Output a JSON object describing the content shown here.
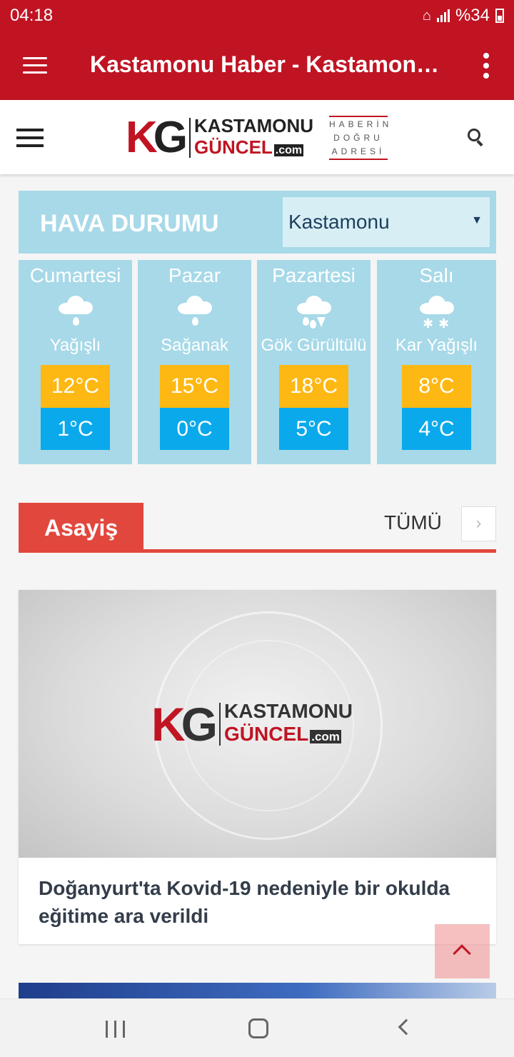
{
  "status_bar": {
    "time": "04:18",
    "battery": "%34",
    "icons": [
      "wifi-icon",
      "signal-icon",
      "battery-icon"
    ]
  },
  "app_bar": {
    "title": "Kastamonu Haber - Kastamon…",
    "icons": [
      "menu-icon",
      "more-vert-icon"
    ]
  },
  "site_header": {
    "logo": {
      "k": "K",
      "g": "G",
      "word1": "KASTAMONU",
      "word2": "GÜNCEL",
      "com": ".com"
    },
    "slogan": [
      "HABERİN",
      "DOĞRU",
      "ADRESİ"
    ],
    "icons": [
      "hamburger-icon",
      "search-icon"
    ]
  },
  "weather": {
    "title": "HAVA DURUMU",
    "city": "Kastamonu",
    "days": [
      {
        "name": "Cumartesi",
        "condition": "Yağışlı",
        "high": "12°C",
        "low": "1°C",
        "icon": "rain-icon"
      },
      {
        "name": "Pazar",
        "condition": "Sağanak",
        "high": "15°C",
        "low": "0°C",
        "icon": "shower-icon"
      },
      {
        "name": "Pazartesi",
        "condition": "Gök Gürültülü",
        "high": "18°C",
        "low": "5°C",
        "icon": "thunderstorm-icon"
      },
      {
        "name": "Salı",
        "condition": "Kar Yağışlı",
        "high": "8°C",
        "low": "4°C",
        "icon": "snow-icon"
      }
    ]
  },
  "section": {
    "title": "Asayiş",
    "all_label": "TÜMÜ",
    "next_glyph": "›"
  },
  "news": [
    {
      "headline": "Doğanyurt'ta Kovid-19 nedeniyle bir okulda eğitime ara verildi"
    }
  ],
  "colors": {
    "brand_red": "#c01423",
    "weather_bg": "#a7d9e8",
    "high_temp": "#fdb813",
    "low_temp": "#0aa9ec",
    "section_red": "#e2473d"
  }
}
